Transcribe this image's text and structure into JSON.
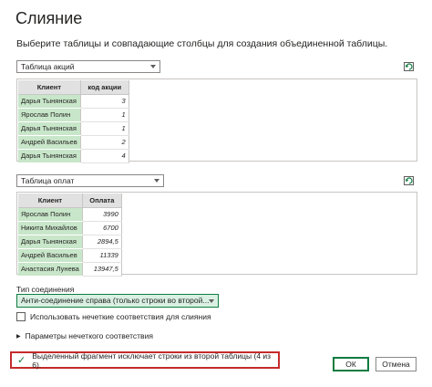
{
  "dialog": {
    "title": "Слияние",
    "subtitle": "Выберите таблицы и совпадающие столбцы для создания объединенной таблицы."
  },
  "table1": {
    "dropdown_value": "Таблица акций",
    "columns": [
      "Клиент",
      "код акции"
    ],
    "rows": [
      [
        "Дарья Тынянская",
        "3"
      ],
      [
        "Ярослав Полин",
        "1"
      ],
      [
        "Дарья Тынянская",
        "1"
      ],
      [
        "Андрей Васильев",
        "2"
      ],
      [
        "Дарья Тынянская",
        "4"
      ]
    ]
  },
  "table2": {
    "dropdown_value": "Таблица оплат",
    "columns": [
      "Клиент",
      "Оплата"
    ],
    "rows": [
      [
        "Ярослав Полин",
        "3990"
      ],
      [
        "Никита Михайлов",
        "6700"
      ],
      [
        "Дарья Тынянская",
        "2894,5"
      ],
      [
        "Андрей Васильев",
        "11339"
      ],
      [
        "Анастасия Лунева",
        "13947,5"
      ]
    ]
  },
  "join": {
    "label": "Тип соединения",
    "value": "Анти-соединение справа (только строки во второй..."
  },
  "fuzzy": {
    "checkbox_label": "Использовать нечеткие соответствия для слияния",
    "options_label": "Параметры нечеткого соответствия"
  },
  "status": {
    "message": "Выделенный фрагмент исключает строки из второй таблицы (4 из 6)."
  },
  "buttons": {
    "ok": "ОК",
    "cancel": "Отмена"
  },
  "colors": {
    "accent": "#107c41",
    "highlight_border": "#c42b2b",
    "key_column_fill": "#c8e6c9"
  },
  "icons": {
    "refresh": "refresh-icon",
    "check": "checkmark-icon",
    "expand": "chevron-right-icon"
  }
}
